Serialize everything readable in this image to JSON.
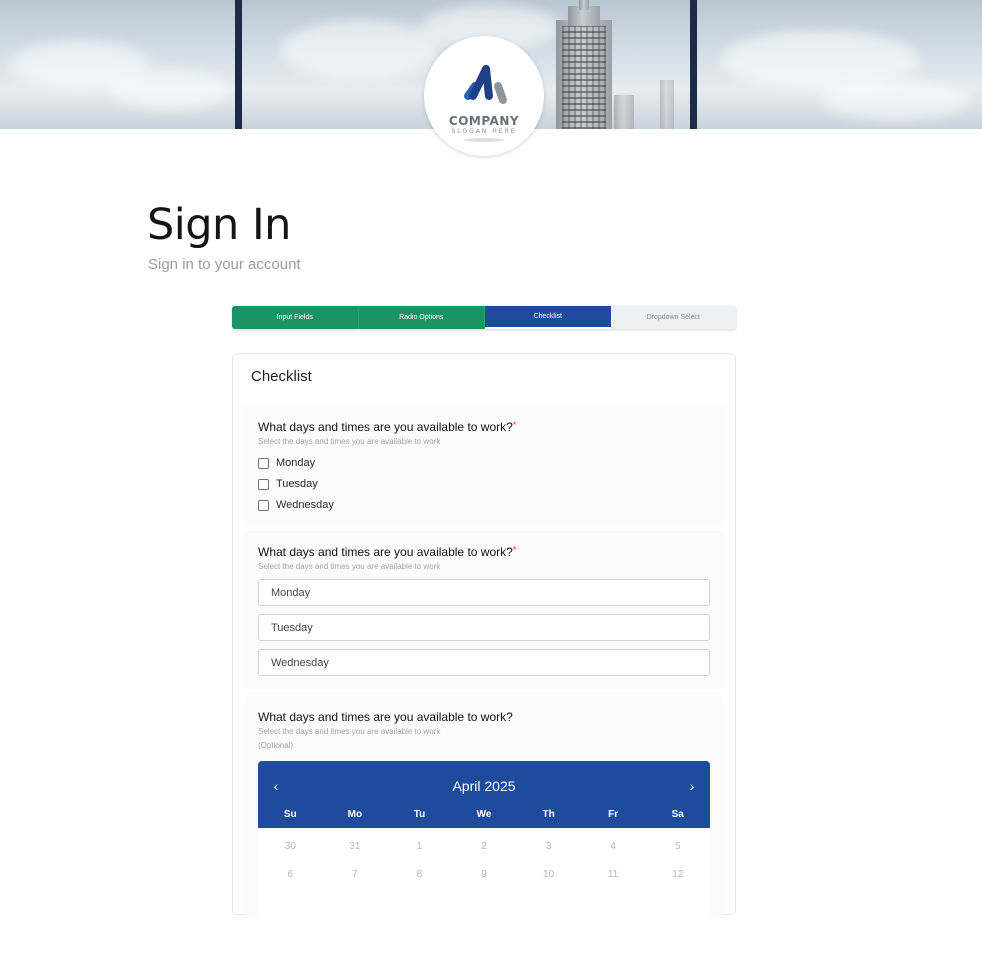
{
  "logo": {
    "word": "COMPANY",
    "slogan": "SLOGAN HERE"
  },
  "page": {
    "title": "Sign In",
    "subtitle": "Sign in to your account"
  },
  "steps": [
    {
      "label": "Input Fields",
      "state": "done"
    },
    {
      "label": "Radio Options",
      "state": "done"
    },
    {
      "label": "Checklist",
      "state": "active"
    },
    {
      "label": "Dropdown Select",
      "state": "pending"
    }
  ],
  "card": {
    "title": "Checklist",
    "section1": {
      "question": "What days and times are you available to work?",
      "required_mark": "*",
      "hint": "Select the days and times you are available to work",
      "options": [
        "Monday",
        "Tuesday",
        "Wednesday"
      ]
    },
    "section2": {
      "question": "What days and times are you available to work?",
      "required_mark": "*",
      "hint": "Select the days and times you are available to work",
      "options": [
        "Monday",
        "Tuesday",
        "Wednesday"
      ]
    },
    "section3": {
      "question": "What days and times are you available to work?",
      "hint": "Select the days and times you are available to work",
      "optional": "(Optional)",
      "calendar": {
        "month": "April 2025",
        "prev": "‹",
        "next": "›",
        "weekdays": [
          "Su",
          "Mo",
          "Tu",
          "We",
          "Th",
          "Fr",
          "Sa"
        ],
        "week1": [
          "30",
          "31",
          "1",
          "2",
          "3",
          "4",
          "5"
        ],
        "week2": [
          "6",
          "7",
          "8",
          "9",
          "10",
          "11",
          "12"
        ]
      }
    }
  },
  "colors": {
    "done": "#1b9364",
    "active": "#1f4b9c",
    "pending": "#eef0f2",
    "required": "#dd3333"
  }
}
